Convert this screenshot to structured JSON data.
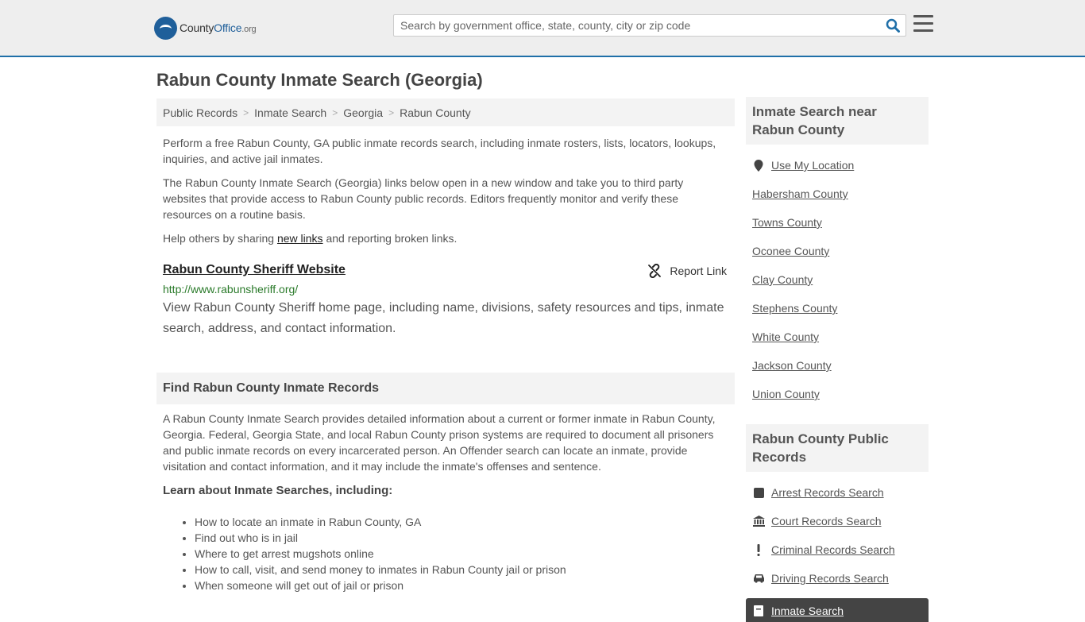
{
  "header": {
    "logo_main": "County",
    "logo_accent": "Office",
    "logo_tld": ".org",
    "search_placeholder": "Search by government office, state, county, city or zip code"
  },
  "page_title": "Rabun County Inmate Search (Georgia)",
  "breadcrumb": [
    "Public Records",
    "Inmate Search",
    "Georgia",
    "Rabun County"
  ],
  "intro": {
    "p1": "Perform a free Rabun County, GA public inmate records search, including inmate rosters, lists, locators, lookups, inquiries, and active jail inmates.",
    "p2": "The Rabun County Inmate Search (Georgia) links below open in a new window and take you to third party websites that provide access to Rabun County public records. Editors frequently monitor and verify these resources on a routine basis.",
    "p3_before": "Help others by sharing ",
    "p3_link": "new links",
    "p3_after": " and reporting broken links."
  },
  "link_item": {
    "title": "Rabun County Sheriff Website",
    "report_label": "Report Link",
    "url": "http://www.rabunsheriff.org/",
    "description": "View Rabun County Sheriff home page, including name, divisions, safety resources and tips, inmate search, address, and contact information."
  },
  "find_section": {
    "heading": "Find Rabun County Inmate Records",
    "body": "A Rabun County Inmate Search provides detailed information about a current or former inmate in Rabun County, Georgia. Federal, Georgia State, and local Rabun County prison systems are required to document all prisoners and public inmate records on every incarcerated person. An Offender search can locate an inmate, provide visitation and contact information, and it may include the inmate's offenses and sentence.",
    "learn_heading": "Learn about Inmate Searches, including:",
    "learn_items": [
      "How to locate an inmate in Rabun County, GA",
      "Find out who is in jail",
      "Where to get arrest mugshots online",
      "How to call, visit, and send money to inmates in Rabun County jail or prison",
      "When someone will get out of jail or prison"
    ]
  },
  "sidebar": {
    "nearby_heading": "Inmate Search near Rabun County",
    "use_location": "Use My Location",
    "counties": [
      "Habersham County",
      "Towns County",
      "Oconee County",
      "Clay County",
      "Stephens County",
      "White County",
      "Jackson County",
      "Union County"
    ],
    "records_heading": "Rabun County Public Records",
    "records": [
      {
        "label": "Arrest Records Search",
        "icon": "square-icon"
      },
      {
        "label": "Court Records Search",
        "icon": "courthouse-icon"
      },
      {
        "label": "Criminal Records Search",
        "icon": "exclamation-icon"
      },
      {
        "label": "Driving Records Search",
        "icon": "car-icon"
      }
    ],
    "active_item": "Inmate Search"
  },
  "colors": {
    "brand_blue": "#1f5f9a",
    "header_bg": "#eeeeee",
    "url_green": "#2a7a2a",
    "active_bg": "#444444"
  }
}
